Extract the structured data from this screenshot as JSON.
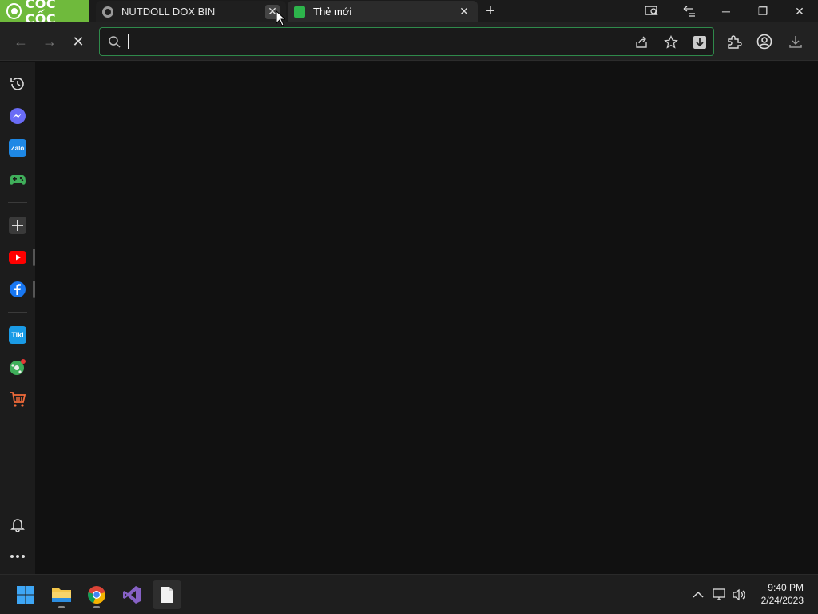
{
  "browser": {
    "logo_text": "CỐC CỐC",
    "tabs": [
      {
        "title": "NUTDOLL DOX BIN",
        "favicon": "globe-icon",
        "close": "✕"
      },
      {
        "title": "Thẻ mới",
        "favicon": "new-tab-square-icon",
        "close": "✕"
      }
    ],
    "new_tab": "+",
    "window_controls": {
      "minimize": "─",
      "restore": "❐",
      "close": "✕"
    }
  },
  "toolbar": {
    "back": "←",
    "forward": "→",
    "stop": "✕",
    "address_value": "",
    "address_placeholder": ""
  },
  "sidebar": {
    "items": [
      "history-icon",
      "messenger-icon",
      "zalo-icon",
      "games-icon",
      "add-icon",
      "youtube-icon",
      "facebook-icon",
      "tiki-icon",
      "soccer-icon",
      "shopping-cart-icon",
      "notifications-icon",
      "more-icon"
    ],
    "zalo_label": "Zalo",
    "tiki_label": "Tiki"
  },
  "taskbar": {
    "apps": [
      "windows-start",
      "file-explorer",
      "chrome",
      "visual-studio",
      "notepad"
    ],
    "tray": {
      "overflow": "^"
    },
    "clock": {
      "time": "9:40 PM",
      "date": "2/24/2023"
    }
  },
  "colors": {
    "brand_green": "#6fba3c",
    "focus_border": "#2f8a4b",
    "youtube": "#ff0000",
    "facebook": "#1877f2"
  }
}
